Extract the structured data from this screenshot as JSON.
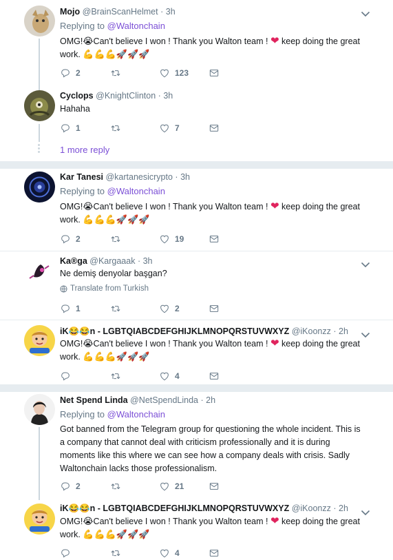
{
  "tweets": [
    {
      "name": "Mojo",
      "handle": "@BrainScanHelmet",
      "time": "3h",
      "reply_prefix": "Replying to",
      "reply_handle": "@Waltonchain",
      "text_a": "OMG!",
      "emoji_cry": "😭",
      "text_b": "Can't believe I won ! Thank you Walton team ! ",
      "heart": "❤",
      "text_c": " keep doing the great",
      "text_d": "work. ",
      "emoji_tail": "💪💪💪🚀🚀🚀",
      "replies": "2",
      "retweets": "",
      "likes": "123"
    },
    {
      "name": "Cyclops",
      "handle": "@KnightClinton",
      "time": "3h",
      "text": "Hahaha",
      "replies": "1",
      "retweets": "",
      "likes": "7"
    },
    {
      "name": "Kar Tanesi",
      "handle": "@kartanesicrypto",
      "time": "3h",
      "reply_prefix": "Replying to",
      "reply_handle": "@Waltonchain",
      "text_a": "OMG!",
      "emoji_cry": "😭",
      "text_b": "Can't believe I won ! Thank you Walton team ! ",
      "heart": "❤",
      "text_c": " keep doing the great",
      "text_d": "work. ",
      "emoji_tail": "💪💪💪🚀🚀🚀",
      "replies": "2",
      "retweets": "",
      "likes": "19"
    },
    {
      "name": "Ka®ga",
      "handle": "@Kargaaak",
      "time": "3h",
      "text": "Ne demiş denyolar başgan?",
      "translate": "Translate from Turkish",
      "replies": "1",
      "retweets": "",
      "likes": "2"
    },
    {
      "name": "iK😂😂n - LGBTQIABCDEFGHIJKLMNOPQRSTUVWXYZ",
      "handle": "@iKoonzz",
      "time": "2h",
      "text_a": "OMG!",
      "emoji_cry": "😭",
      "text_b": "Can't believe I won ! Thank you Walton team ! ",
      "heart": "❤",
      "text_c": " keep doing the great",
      "text_d": "work. ",
      "emoji_tail": "💪💪💪🚀🚀🚀",
      "replies": "",
      "retweets": "",
      "likes": "4"
    },
    {
      "name": "Net Spend Linda",
      "handle": "@NetSpendLinda",
      "time": "2h",
      "reply_prefix": "Replying to",
      "reply_handle": "@Waltonchain",
      "lines": [
        "Got banned from the Telegram group for questioning the whole incident. This is",
        "a company that cannot deal with criticism professionally and it is during",
        "moments like this where we can see how a company deals with crisis. Sadly",
        "Waltonchain lacks those professionalism."
      ],
      "replies": "2",
      "retweets": "",
      "likes": "21"
    },
    {
      "name": "iK😂😂n - LGBTQIABCDEFGHIJKLMNOPQRSTUVWXYZ",
      "handle": "@iKoonzz",
      "time": "2h",
      "text_a": "OMG!",
      "emoji_cry": "😭",
      "text_b": "Can't believe I won ! Thank you Walton team ! ",
      "heart": "❤",
      "text_c": " keep doing the great",
      "text_d": "work. ",
      "emoji_tail": "💪💪💪🚀🚀🚀",
      "replies": "",
      "retweets": "",
      "likes": "4"
    }
  ],
  "dot_sep": "·",
  "more_reply": "1 more reply",
  "colors": {
    "accent": "#7b4fd6",
    "muted": "#657786",
    "heart": "#e0245e",
    "separator": "#e6ecf0"
  }
}
